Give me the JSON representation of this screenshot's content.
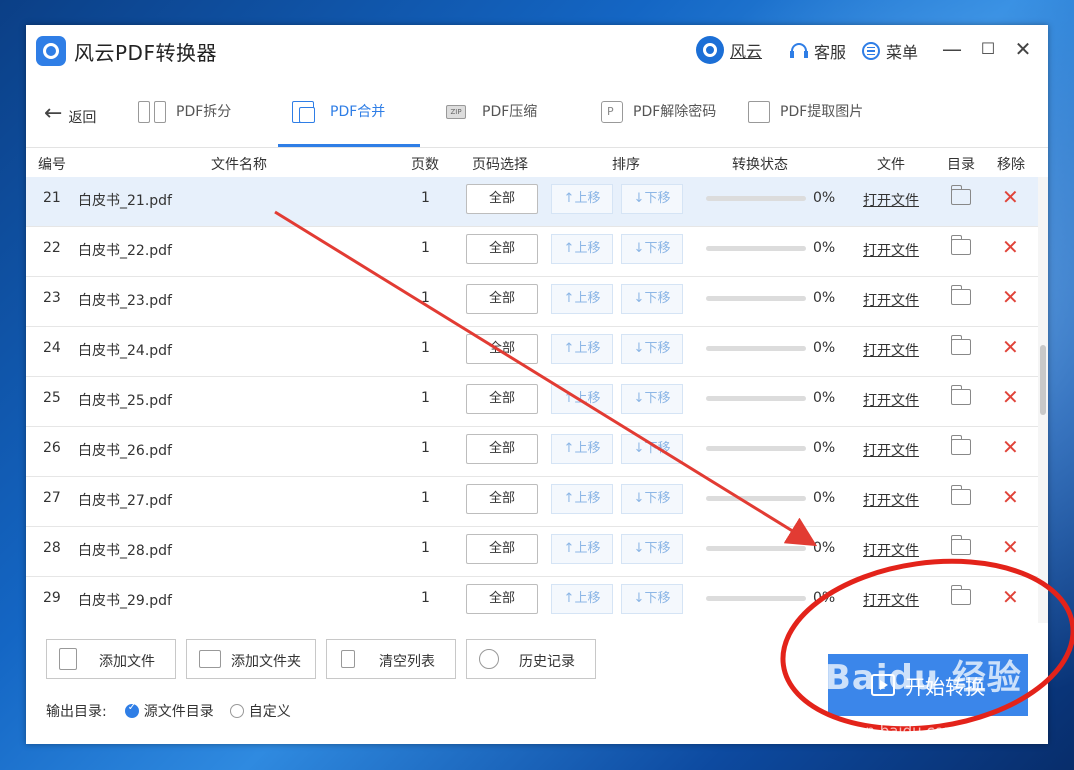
{
  "app": {
    "title": "风云PDF转换器",
    "account_label": "风云",
    "service_label": "客服",
    "menu_label": "菜单",
    "accent": "#2f7ee6"
  },
  "tabs": {
    "back_label": "返回",
    "items": [
      {
        "label": "PDF拆分",
        "icon": "split-icon"
      },
      {
        "label": "PDF合并",
        "icon": "merge-icon",
        "active": true
      },
      {
        "label": "PDF压缩",
        "icon": "zip-icon"
      },
      {
        "label": "PDF解除密码",
        "icon": "unlock-icon"
      },
      {
        "label": "PDF提取图片",
        "icon": "image-icon"
      }
    ]
  },
  "table": {
    "headers": [
      "编号",
      "文件名称",
      "页数",
      "页码选择",
      "排序",
      "转换状态",
      "文件",
      "目录",
      "移除"
    ],
    "all_label": "全部",
    "up_label": "↑上移",
    "down_label": "↓下移",
    "open_label": "打开文件",
    "rows": [
      {
        "num": "21",
        "name": "白皮书_21.pdf",
        "pages": "1",
        "progress": "0%",
        "selected": true
      },
      {
        "num": "22",
        "name": "白皮书_22.pdf",
        "pages": "1",
        "progress": "0%"
      },
      {
        "num": "23",
        "name": "白皮书_23.pdf",
        "pages": "1",
        "progress": "0%"
      },
      {
        "num": "24",
        "name": "白皮书_24.pdf",
        "pages": "1",
        "progress": "0%"
      },
      {
        "num": "25",
        "name": "白皮书_25.pdf",
        "pages": "1",
        "progress": "0%"
      },
      {
        "num": "26",
        "name": "白皮书_26.pdf",
        "pages": "1",
        "progress": "0%"
      },
      {
        "num": "27",
        "name": "白皮书_27.pdf",
        "pages": "1",
        "progress": "0%"
      },
      {
        "num": "28",
        "name": "白皮书_28.pdf",
        "pages": "1",
        "progress": "0%"
      },
      {
        "num": "29",
        "name": "白皮书_29.pdf",
        "pages": "1",
        "progress": "0%"
      }
    ]
  },
  "bottom": {
    "add_file": "添加文件",
    "add_folder": "添加文件夹",
    "clear_list": "清空列表",
    "history": "历史记录",
    "output_label": "输出目录:",
    "source_dir": "源文件目录",
    "custom": "自定义",
    "start_label": "开始转换"
  },
  "overlay": {
    "watermark": "Baidu 经验",
    "watermark_url": "jingyan.baidu.com"
  }
}
